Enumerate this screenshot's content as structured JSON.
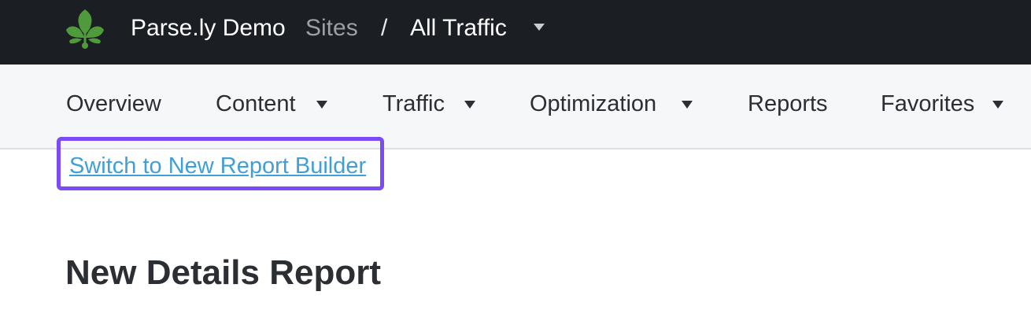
{
  "header": {
    "brand": "Parse.ly Demo",
    "sites_label": "Sites",
    "separator": "/",
    "traffic_selector": "All Traffic"
  },
  "nav": {
    "items": [
      {
        "label": "Overview",
        "has_dropdown": false
      },
      {
        "label": "Content",
        "has_dropdown": true
      },
      {
        "label": "Traffic",
        "has_dropdown": true
      },
      {
        "label": "Optimization",
        "has_dropdown": true
      },
      {
        "label": "Reports",
        "has_dropdown": false
      },
      {
        "label": "Favorites",
        "has_dropdown": true
      }
    ]
  },
  "main": {
    "switch_link": "Switch to New Report Builder",
    "title": "New Details Report"
  },
  "colors": {
    "header_bg": "#1b1e23",
    "nav_bg": "#f6f7f9",
    "link": "#3f9fd6",
    "highlight": "#7b4cf5",
    "logo_green": "#4f9a3a"
  }
}
